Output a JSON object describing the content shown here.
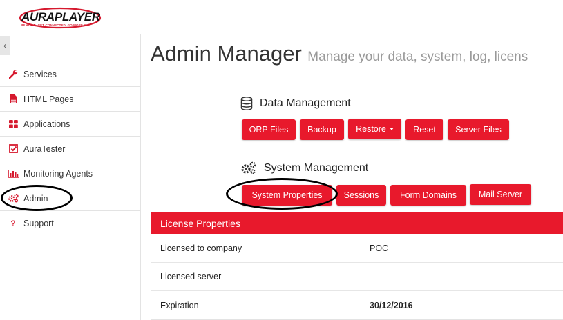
{
  "brand": {
    "name": "AURAPLAYER",
    "tagline": "BE AGILE. GET CONNECTED. GO MOBILE",
    "accent": "#e8192c"
  },
  "sidebar": {
    "collapse_glyph": "‹",
    "items": [
      {
        "label": "Services",
        "icon": "wrench-icon"
      },
      {
        "label": "HTML Pages",
        "icon": "file-icon"
      },
      {
        "label": "Applications",
        "icon": "grid-icon"
      },
      {
        "label": "AuraTester",
        "icon": "checkbox-icon"
      },
      {
        "label": "Monitoring Agents",
        "icon": "bar-chart-icon"
      },
      {
        "label": "Admin",
        "icon": "gears-icon"
      },
      {
        "label": "Support",
        "icon": "question-icon"
      }
    ]
  },
  "main": {
    "title": "Admin Manager",
    "subtitle": "Manage your data, system, log, licens"
  },
  "data_management": {
    "heading": "Data Management",
    "icon": "database-icon",
    "buttons": [
      "ORP Files",
      "Backup",
      "Restore",
      "Reset",
      "Server Files"
    ]
  },
  "system_management": {
    "heading": "System Management",
    "icon": "gears-icon",
    "buttons": [
      "System Properties",
      "Sessions",
      "Form Domains",
      "Mail Server"
    ]
  },
  "license": {
    "heading": "License Properties",
    "rows": [
      {
        "key": "Licensed to company",
        "value": "POC"
      },
      {
        "key": "Licensed server",
        "value": ""
      },
      {
        "key": "Expiration",
        "value": "30/12/2016"
      }
    ]
  }
}
